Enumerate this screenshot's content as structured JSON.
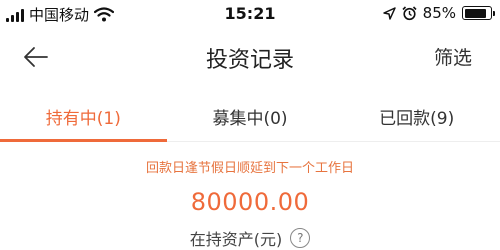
{
  "status_bar": {
    "carrier": "中国移动",
    "time": "15:21",
    "battery": "85%",
    "battery_level": 0.85,
    "icons": [
      "signal-icon",
      "wifi-icon",
      "location-icon",
      "alarm-icon",
      "battery-icon"
    ]
  },
  "nav": {
    "title": "投资记录",
    "filter_label": "筛选",
    "back_icon": "arrow-left-icon"
  },
  "tabs": [
    {
      "label": "持有中(1)",
      "active": true
    },
    {
      "label": "募集中(0)",
      "active": false
    },
    {
      "label": "已回款(9)",
      "active": false
    }
  ],
  "summary": {
    "notice": "回款日逢节假日顺延到下一个工作日",
    "amount": "80000.00",
    "asset_label": "在持资产(元)",
    "help_icon": "?"
  },
  "colors": {
    "accent": "#ef6a3a",
    "notice": "#e7743f"
  }
}
